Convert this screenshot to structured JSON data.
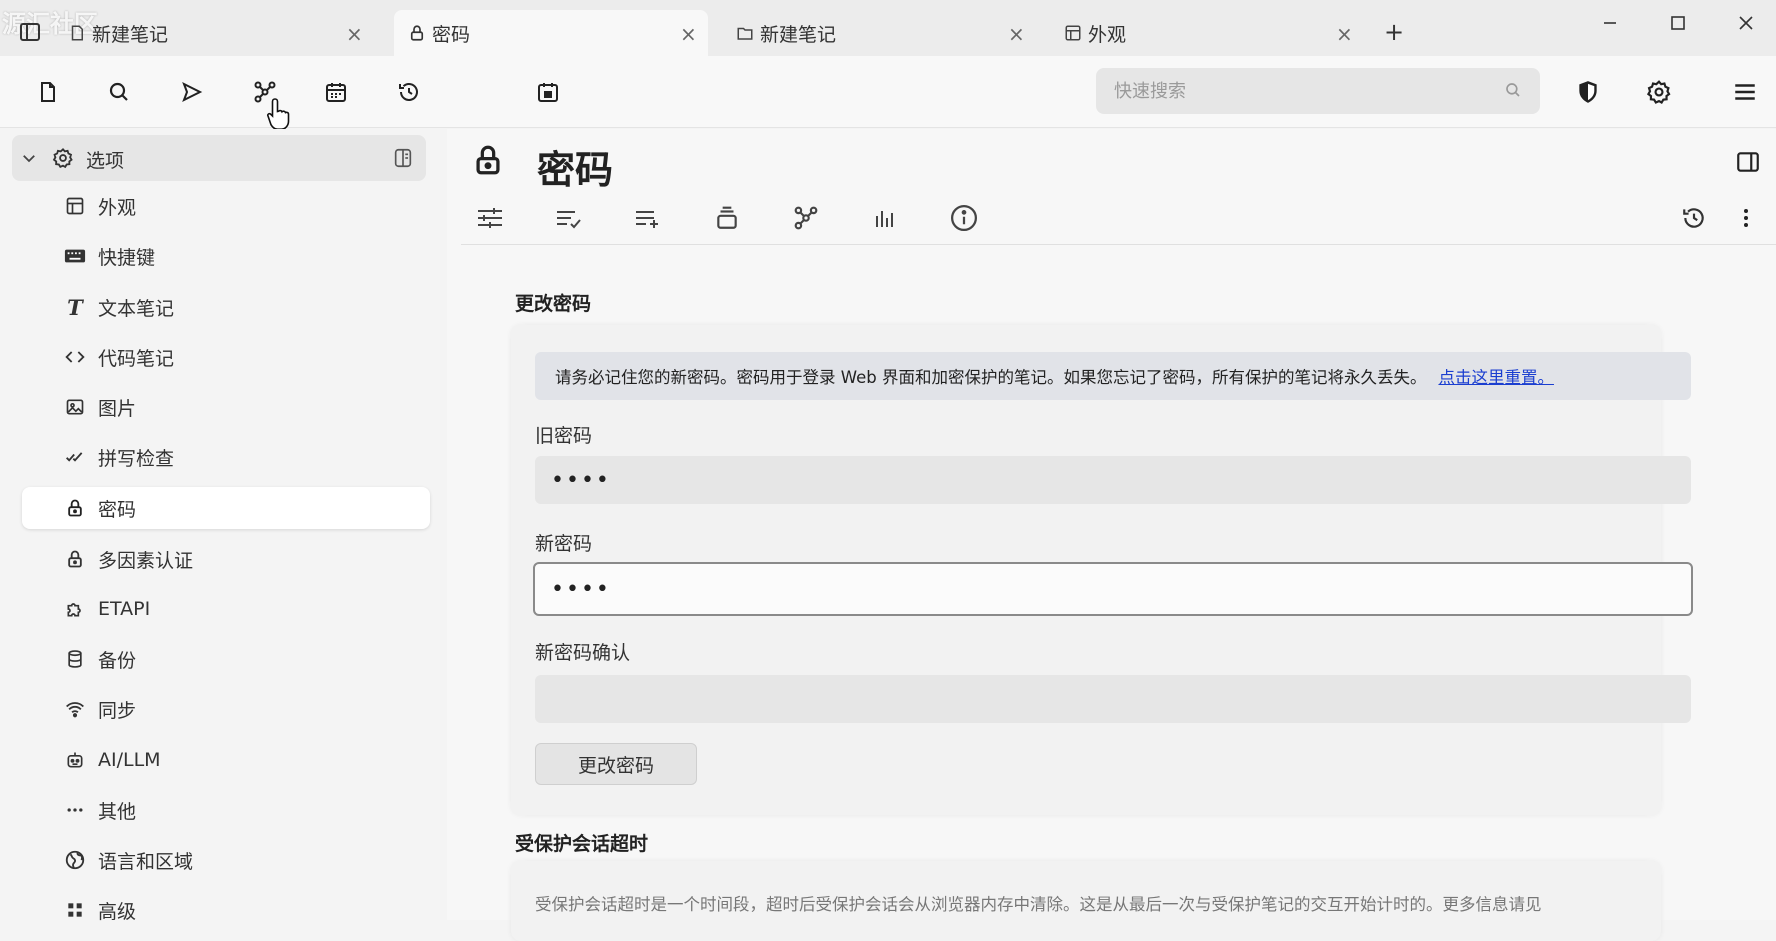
{
  "watermark": "源汇社区",
  "tabs": [
    {
      "label": "新建笔记",
      "icon": "note-icon",
      "active": false
    },
    {
      "label": "密码",
      "icon": "lock-icon",
      "active": true
    },
    {
      "label": "新建笔记",
      "icon": "folder-icon",
      "active": false
    },
    {
      "label": "外观",
      "icon": "layout-icon",
      "active": false
    }
  ],
  "tab_close": "×",
  "tab_new": "+",
  "search": {
    "placeholder": "快速搜索"
  },
  "sidebar": {
    "root_label": "选项",
    "items": [
      {
        "label": "外观",
        "icon": "layout-icon"
      },
      {
        "label": "快捷键",
        "icon": "keyboard-icon"
      },
      {
        "label": "文本笔记",
        "icon": "text-icon"
      },
      {
        "label": "代码笔记",
        "icon": "code-icon"
      },
      {
        "label": "图片",
        "icon": "image-icon"
      },
      {
        "label": "拼写检查",
        "icon": "spellcheck-icon"
      },
      {
        "label": "密码",
        "icon": "lock-icon",
        "active": true
      },
      {
        "label": "多因素认证",
        "icon": "lock-icon"
      },
      {
        "label": "ETAPI",
        "icon": "puzzle-icon"
      },
      {
        "label": "备份",
        "icon": "database-icon"
      },
      {
        "label": "同步",
        "icon": "wifi-icon"
      },
      {
        "label": "AI/LLM",
        "icon": "robot-icon"
      },
      {
        "label": "其他",
        "icon": "dots-icon"
      },
      {
        "label": "语言和区域",
        "icon": "globe-icon"
      },
      {
        "label": "高级",
        "icon": "advanced-icon"
      }
    ]
  },
  "note": {
    "title": "密码"
  },
  "change_password": {
    "section_title": "更改密码",
    "notice": "请务必记住您的新密码。密码用于登录 Web 界面和加密保护的笔记。如果您忘记了密码，所有保护的笔记将永久丢失。",
    "notice_link": "点击这里重置。",
    "old_label": "旧密码",
    "old_value": "••••",
    "new_label": "新密码",
    "new_value": "••••",
    "confirm_label": "新密码确认",
    "confirm_value": "",
    "button_label": "更改密码"
  },
  "session_timeout": {
    "section_title": "受保护会话超时",
    "description": "受保护会话超时是一个时间段，超时后受保护会话会从浏览器内存中清除。这是从最后一次与受保护笔记的交互开始计时的。更多信息请见"
  }
}
